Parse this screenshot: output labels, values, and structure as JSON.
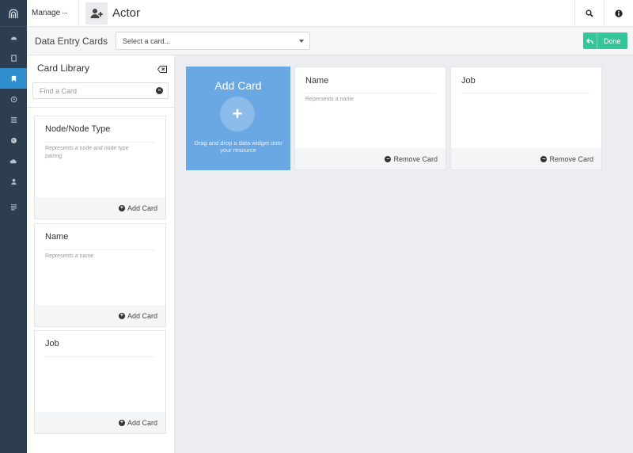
{
  "app": {
    "manage_label": "Manage",
    "manage_dots": "···",
    "resource_title": "Actor"
  },
  "subbar": {
    "label": "Data Entry Cards",
    "select_placeholder": "Select a card...",
    "done_label": "Done"
  },
  "library": {
    "title": "Card Library",
    "search_placeholder": "Find a Card",
    "cards": [
      {
        "title": "Node/Node Type",
        "description": "Represents a node and node type pairing",
        "action": "Add Card"
      },
      {
        "title": "Name",
        "description": "Represents a name",
        "action": "Add Card"
      },
      {
        "title": "Job",
        "description": "",
        "action": "Add Card"
      }
    ]
  },
  "workspace": {
    "add_card": {
      "title": "Add Card",
      "plus": "+",
      "hint": "Drag and drop a data widget onto your resource"
    },
    "cards": [
      {
        "title": "Name",
        "description": "Represents a name",
        "action": "Remove Card"
      },
      {
        "title": "Job",
        "description": "",
        "action": "Remove Card"
      }
    ]
  },
  "colors": {
    "rail": "#2d3e50",
    "rail_active": "#2e8ece",
    "done_button": "#35c59a",
    "add_card_bg": "#6aa8e3"
  },
  "icons": {
    "rail": [
      "logo-arch-icon",
      "dashboard-icon",
      "book-icon",
      "bookmark-icon",
      "clock-icon",
      "list-icon",
      "globe-icon",
      "cloud-icon",
      "user-icon",
      "menu-icon"
    ],
    "header": [
      "user-add-icon",
      "search-icon",
      "info-icon"
    ]
  }
}
